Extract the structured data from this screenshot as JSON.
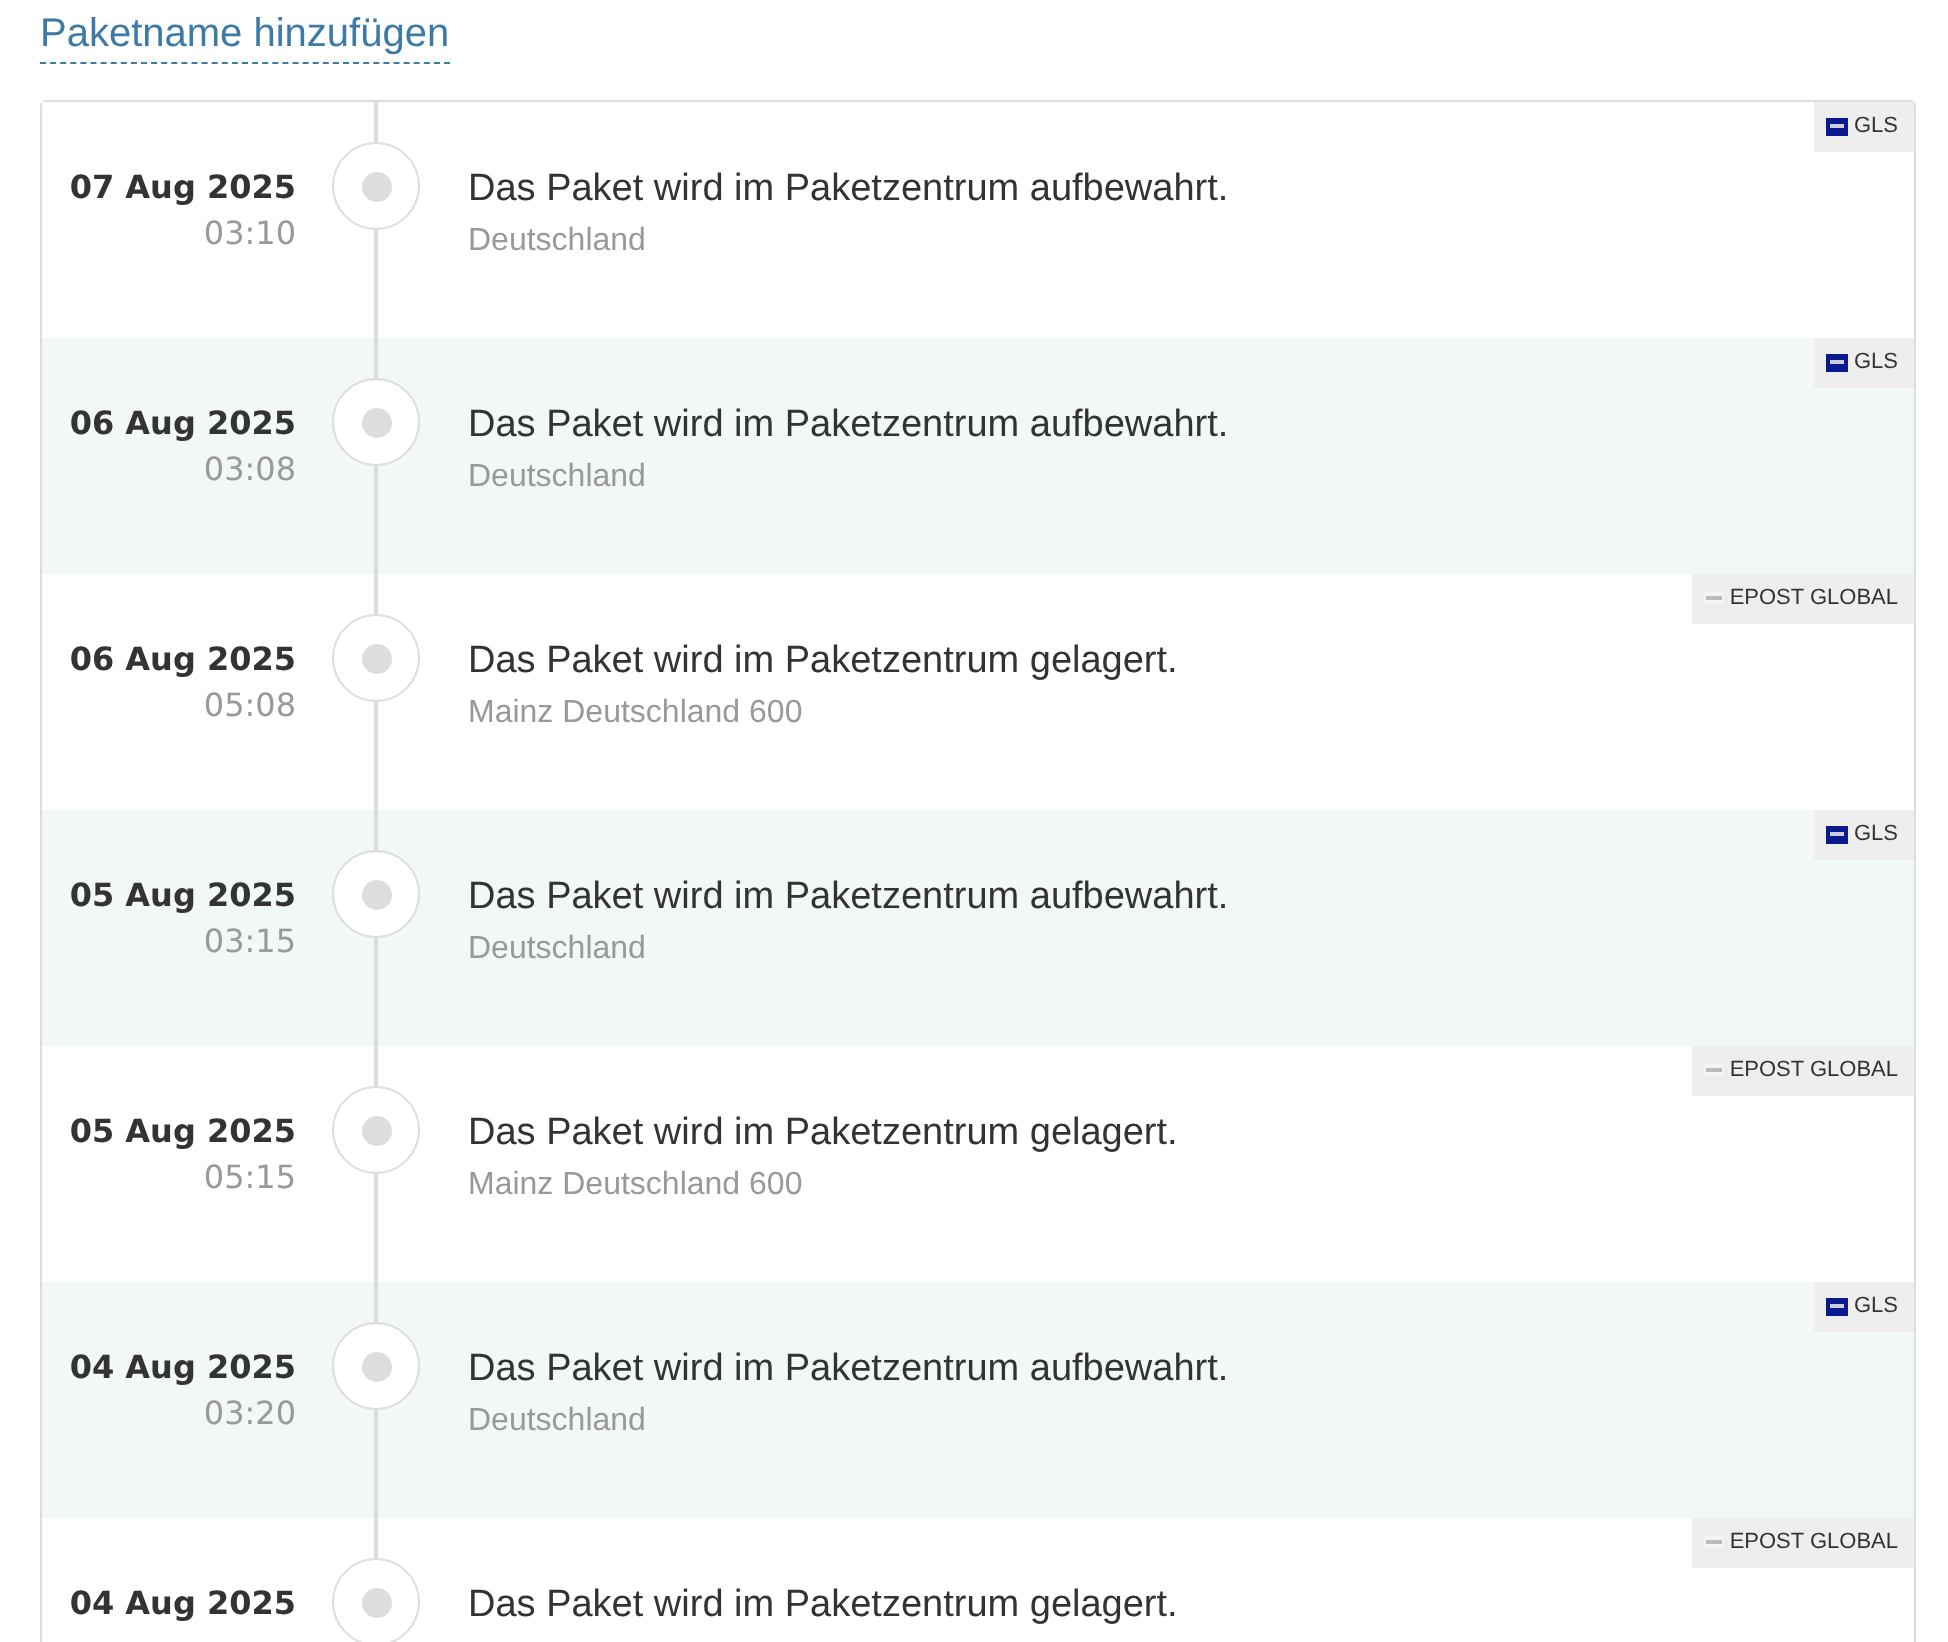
{
  "package_name_link": "Paketname hinzufügen",
  "events": [
    {
      "date": "07 Aug 2025",
      "time": "03:10",
      "message": "Das Paket wird im Paketzentrum aufbewahrt.",
      "location": "Deutschland",
      "carrier": {
        "kind": "gls",
        "name": "GLS"
      }
    },
    {
      "date": "06 Aug 2025",
      "time": "03:08",
      "message": "Das Paket wird im Paketzentrum aufbewahrt.",
      "location": "Deutschland",
      "carrier": {
        "kind": "gls",
        "name": "GLS"
      }
    },
    {
      "date": "06 Aug 2025",
      "time": "05:08",
      "message": "Das Paket wird im Paketzentrum gelagert.",
      "location": "Mainz Deutschland 600",
      "carrier": {
        "kind": "epost",
        "name": "EPOST GLOBAL"
      }
    },
    {
      "date": "05 Aug 2025",
      "time": "03:15",
      "message": "Das Paket wird im Paketzentrum aufbewahrt.",
      "location": "Deutschland",
      "carrier": {
        "kind": "gls",
        "name": "GLS"
      }
    },
    {
      "date": "05 Aug 2025",
      "time": "05:15",
      "message": "Das Paket wird im Paketzentrum gelagert.",
      "location": "Mainz Deutschland 600",
      "carrier": {
        "kind": "epost",
        "name": "EPOST GLOBAL"
      }
    },
    {
      "date": "04 Aug 2025",
      "time": "03:20",
      "message": "Das Paket wird im Paketzentrum aufbewahrt.",
      "location": "Deutschland",
      "carrier": {
        "kind": "gls",
        "name": "GLS"
      }
    },
    {
      "date": "04 Aug 2025",
      "message": "Das Paket wird im Paketzentrum gelagert.",
      "carrier": {
        "kind": "epost",
        "name": "EPOST GLOBAL"
      }
    }
  ]
}
